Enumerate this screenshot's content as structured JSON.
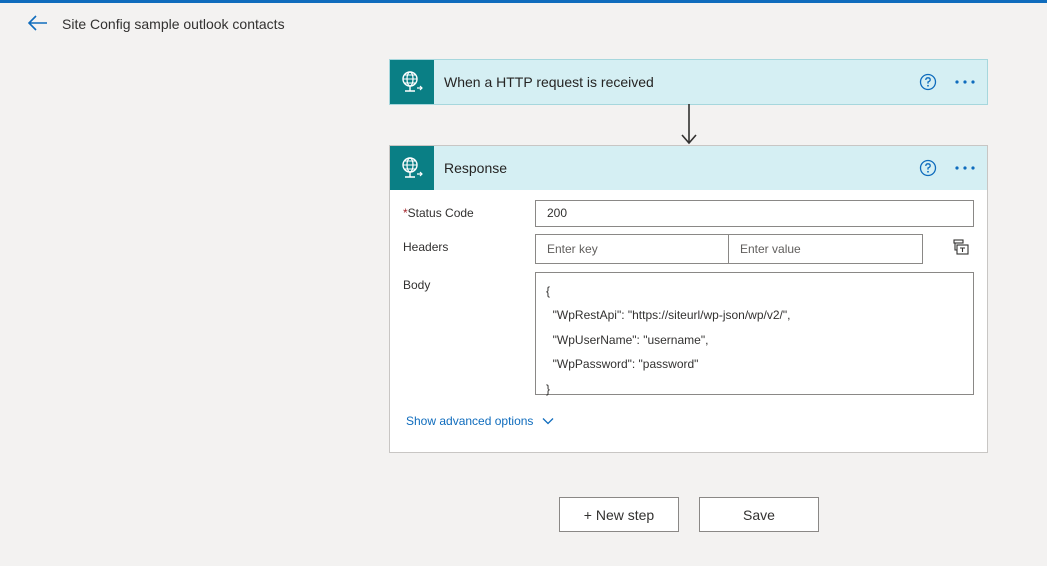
{
  "header": {
    "title": "Site Config sample outlook contacts",
    "back_icon": "arrow-left-icon",
    "accent_color": "#0f6cbd"
  },
  "trigger": {
    "title": "When a HTTP request is received",
    "icon": "globe-http-icon",
    "icon_bg": "#0a7f85",
    "header_bg": "#d5eff3"
  },
  "response": {
    "title": "Response",
    "icon": "globe-http-icon",
    "fields": {
      "status_code_label": "Status Code",
      "required_marker": "*",
      "status_code_value": "200",
      "headers_label": "Headers",
      "headers_key_placeholder": "Enter key",
      "headers_value_placeholder": "Enter value",
      "body_label": "Body",
      "body_lines": [
        "{",
        "  \"WpRestApi\": \"https://siteurl/wp-json/wp/v2/\",",
        "  \"WpUserName\": \"username\",",
        "  \"WpPassword\": \"password\"",
        "}"
      ]
    },
    "advanced_label": "Show advanced options"
  },
  "footer": {
    "new_step_label": "+ New step",
    "save_label": "Save"
  }
}
